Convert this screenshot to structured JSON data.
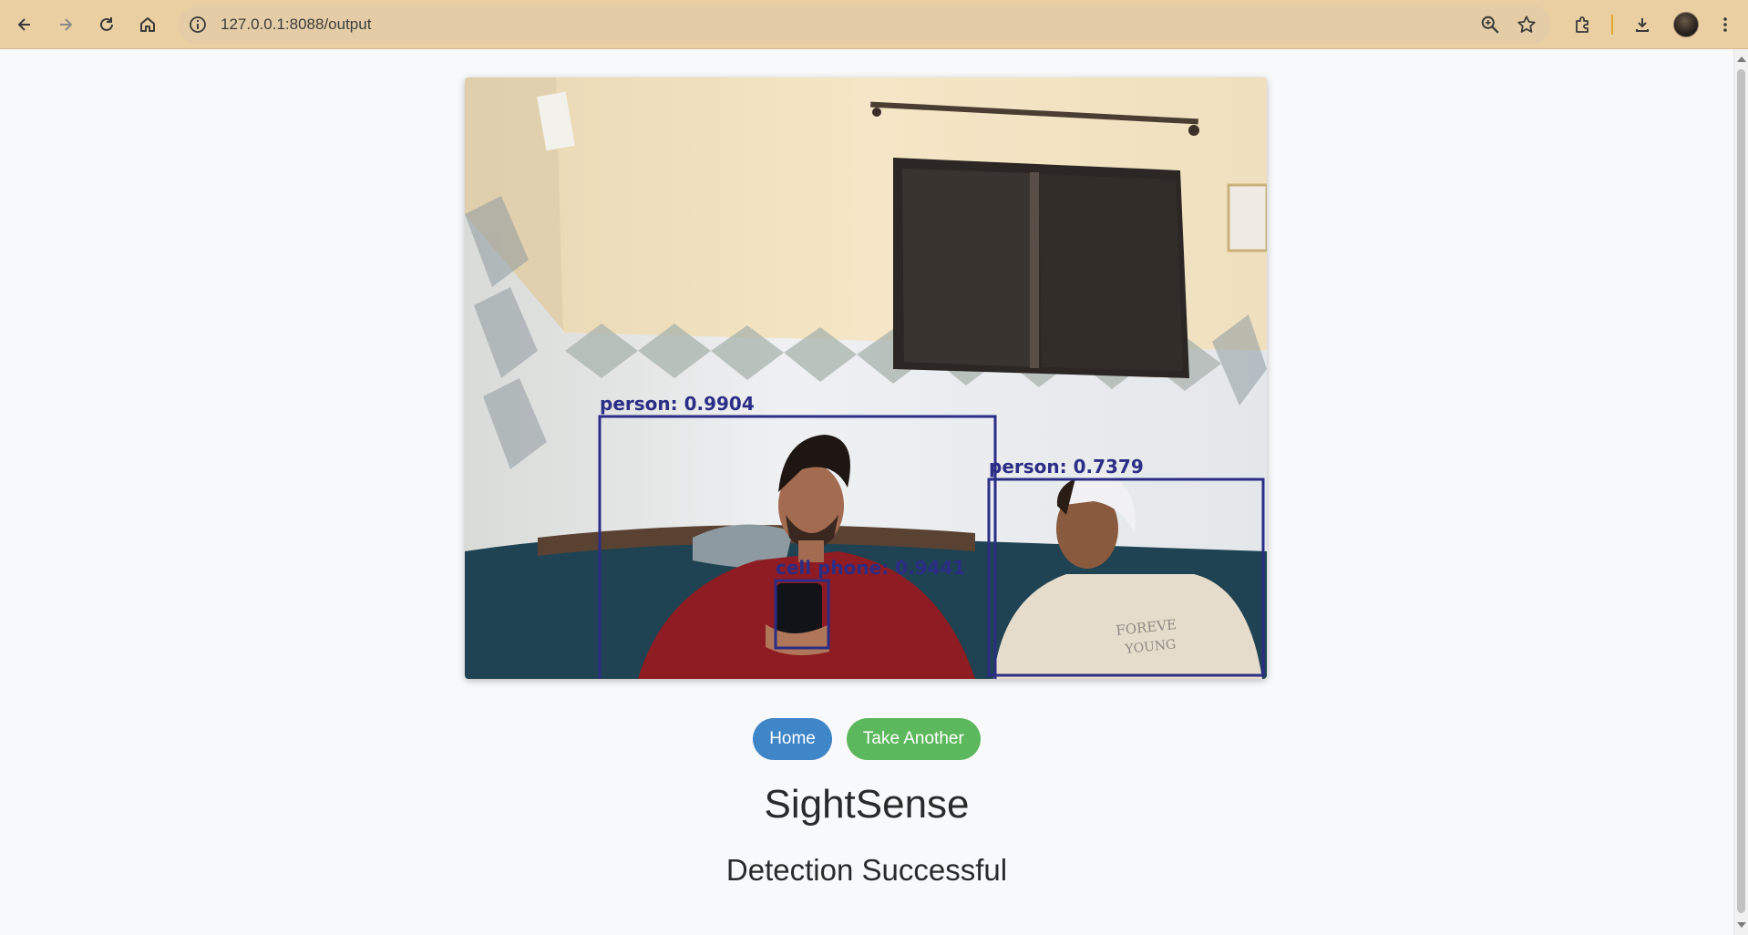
{
  "browser": {
    "url": "127.0.0.1:8088/output",
    "buttons": [
      "back-icon",
      "forward-icon",
      "reload-icon",
      "home-icon"
    ],
    "right_icons": [
      "zoom-icon",
      "bookmark-star-icon",
      "extensions-icon",
      "download-icon",
      "profile-avatar",
      "menu-kebab-icon"
    ],
    "accent": "#e6a52b",
    "bar_color": "#eacfa3"
  },
  "result": {
    "detections": [
      {
        "label": "person: 0.9904"
      },
      {
        "label": "person: 0.7379"
      },
      {
        "label": "cell phone: 0.9441"
      }
    ],
    "box_color": "#2b2d86"
  },
  "actions": {
    "home_label": "Home",
    "take_another_label": "Take Another",
    "home_color": "#3f86c9",
    "take_another_color": "#5cb85c"
  },
  "page": {
    "title": "SightSense",
    "status": "Detection Successful"
  }
}
